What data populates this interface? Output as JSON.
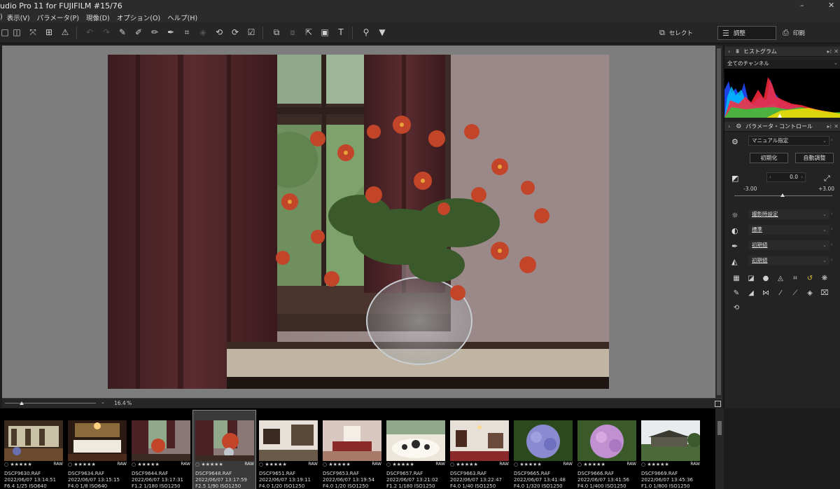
{
  "titlebar": {
    "title": "udio Pro 11 for FUJIFILM   #15/76",
    "minimize": "–",
    "close": "✕"
  },
  "menu": [
    ")",
    "表示(V)",
    "パラメータ(P)",
    "現像(D)",
    "オプション(O)",
    "ヘルプ(H)"
  ],
  "toolbar": {
    "select_label": "セレクト",
    "adjust_label": "調整",
    "print_label": "印刷"
  },
  "viewer": {
    "zoom_value": "16.4",
    "zoom_unit": "%"
  },
  "panel": {
    "histogram": {
      "title": "ヒストグラム",
      "channel": "全てのチャンネル"
    },
    "params": {
      "title": "パラメータ・コントロール",
      "preset": "マニュアル指定",
      "reset_button": "初期化",
      "auto_button": "自動調整",
      "exposure_value": "0.0",
      "exposure_min": "-3.00",
      "exposure_max": "+3.00",
      "white_balance": "撮影時設定",
      "film_sim": "標準",
      "sharpness": "初期値",
      "tone": "初期値"
    }
  },
  "filmstrip": [
    {
      "file": "DSCF9630.RAF",
      "date": "2022/06/07 13:14:51",
      "exif": "F6.4 1/25 ISO640",
      "scene": "hall"
    },
    {
      "file": "DSCF9634.RAF",
      "date": "2022/06/07 13:15:15",
      "exif": "F4.0 1/8 ISO640",
      "scene": "dining"
    },
    {
      "file": "DSCF9644.RAF",
      "date": "2022/06/07 13:17:31",
      "exif": "F1.2 1/180 ISO1250",
      "scene": "flowers"
    },
    {
      "file": "DSCF9648.RAF",
      "date": "2022/06/07 13:17:59",
      "exif": "F2.5 1/90 ISO1250",
      "scene": "flowers2",
      "selected": true
    },
    {
      "file": "DSCF9651.RAF",
      "date": "2022/06/07 13:19:11",
      "exif": "F4.0 1/20 ISO1250",
      "scene": "room"
    },
    {
      "file": "DSCF9653.RAF",
      "date": "2022/06/07 13:19:54",
      "exif": "F4.0 1/20 ISO1250",
      "scene": "bedroom"
    },
    {
      "file": "DSCF9657.RAF",
      "date": "2022/06/07 13:21:02",
      "exif": "F1.2 1/180 ISO1250",
      "scene": "teaset"
    },
    {
      "file": "DSCF9663.RAF",
      "date": "2022/06/07 13:22:47",
      "exif": "F4.0 1/40 ISO1250",
      "scene": "parlor"
    },
    {
      "file": "DSCF9665.RAF",
      "date": "2022/06/07 13:41:48",
      "exif": "F4.0 1/320 ISO1250",
      "scene": "hydrangea"
    },
    {
      "file": "DSCF9666.RAF",
      "date": "2022/06/07 13:41:56",
      "exif": "F4.0 1/400 ISO1250",
      "scene": "hydrangea2"
    },
    {
      "file": "DSCF9669.RAF",
      "date": "2022/06/07 13:45:36",
      "exif": "F1.0 1/800 ISO1250",
      "scene": "house"
    }
  ],
  "rating_stars": "★★★★★",
  "raw_badge": "RAW",
  "colors": {
    "viewer_bg": "#7d7d7d",
    "panel_bg": "#232323",
    "accent": "#e0c030"
  }
}
